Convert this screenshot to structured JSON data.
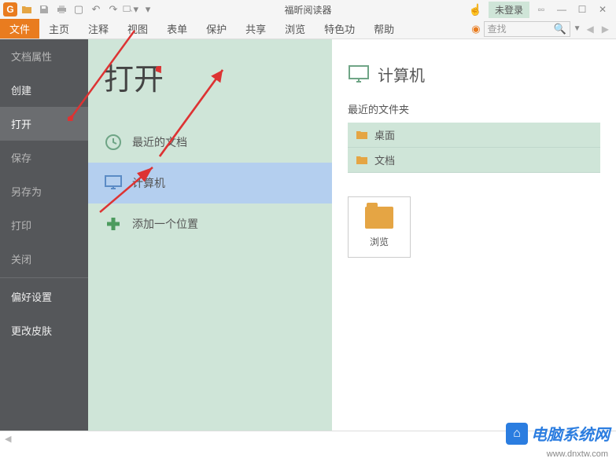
{
  "titlebar": {
    "app_title": "福昕阅读器",
    "login": "未登录"
  },
  "menu": {
    "items": [
      "文件",
      "主页",
      "注释",
      "视图",
      "表单",
      "保护",
      "共享",
      "浏览",
      "特色功",
      "帮助"
    ],
    "search_placeholder": "查找"
  },
  "sidebar": {
    "items": [
      {
        "label": "文档属性"
      },
      {
        "label": "创建"
      },
      {
        "label": "打开"
      },
      {
        "label": "保存"
      },
      {
        "label": "另存为"
      },
      {
        "label": "打印"
      },
      {
        "label": "关闭"
      },
      {
        "label": "偏好设置"
      },
      {
        "label": "更改皮肤"
      }
    ]
  },
  "open_panel": {
    "title": "打开",
    "rows": [
      {
        "label": "最近的文档",
        "icon": "clock"
      },
      {
        "label": "计算机",
        "icon": "monitor"
      },
      {
        "label": "添加一个位置",
        "icon": "plus"
      }
    ]
  },
  "right_panel": {
    "header": "计算机",
    "subheader": "最近的文件夹",
    "folders": [
      "桌面",
      "文档"
    ],
    "browse": "浏览"
  },
  "watermark": {
    "text": "电脑系统网",
    "url": "www.dnxtw.com"
  }
}
